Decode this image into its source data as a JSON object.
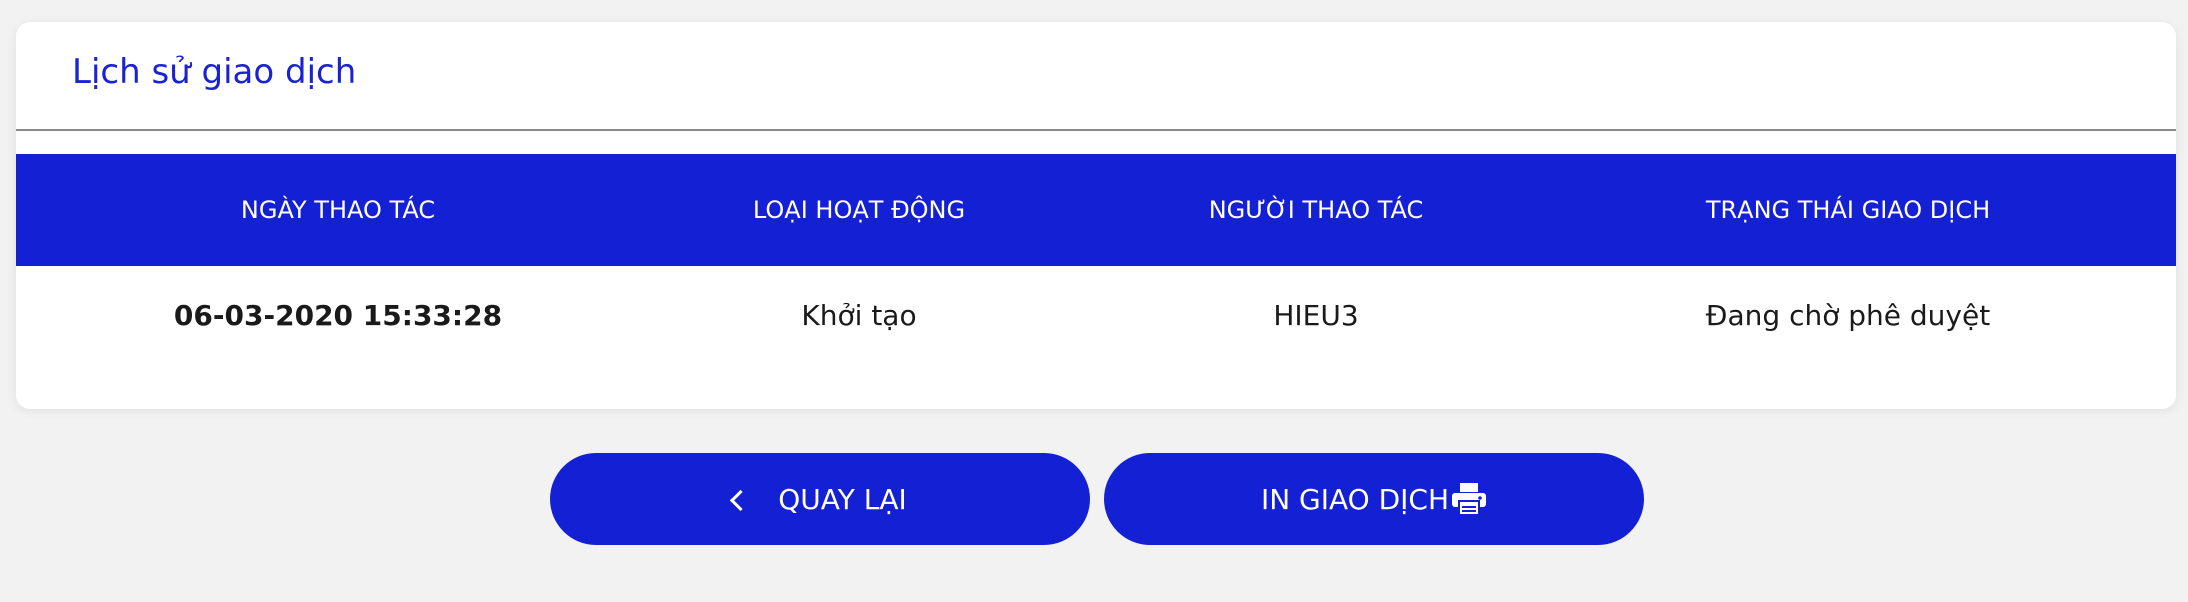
{
  "card": {
    "title": "Lịch sử giao dịch"
  },
  "table": {
    "headers": [
      "NGÀY THAO TÁC",
      "LOẠI HOẠT ĐỘNG",
      "NGƯỜI THAO TÁC",
      "TRẠNG THÁI GIAO DỊCH"
    ],
    "rows": [
      [
        "06-03-2020 15:33:28",
        "Khởi tạo",
        "HIEU3",
        "Đang chờ phê duyệt"
      ]
    ]
  },
  "actions": {
    "back_label": "QUAY LẠI",
    "back_icon": "chevron-left-icon",
    "print_label": "IN GIAO DỊCH",
    "print_icon": "printer-icon"
  },
  "colors": {
    "primary": "#1420d3",
    "title": "#1a22d4",
    "background": "#f2f2f2"
  }
}
